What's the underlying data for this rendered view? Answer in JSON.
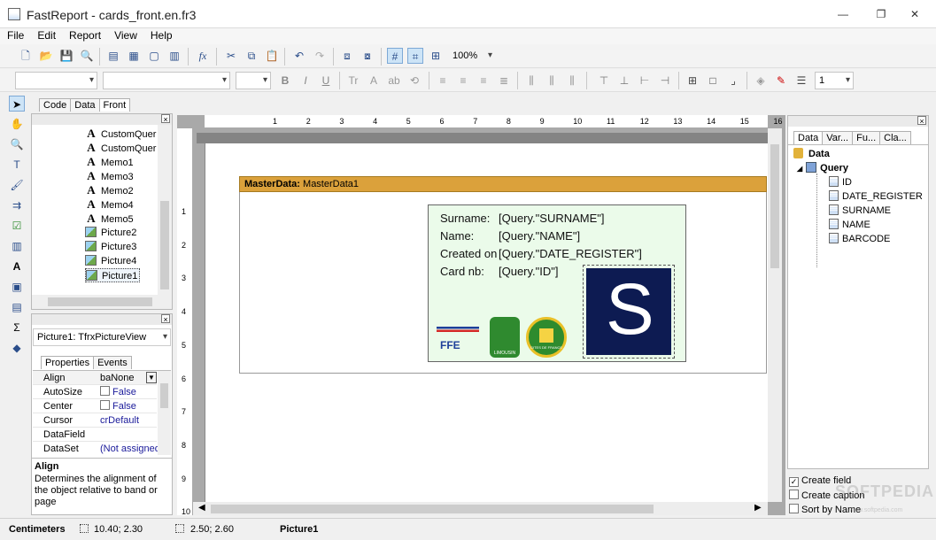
{
  "window": {
    "title": "FastReport - cards_front.en.fr3"
  },
  "menu": [
    "File",
    "Edit",
    "Report",
    "View",
    "Help"
  ],
  "toolbar": {
    "zoom": "100%",
    "line_width": "1"
  },
  "page_tabs": [
    "Code",
    "Data",
    "Front"
  ],
  "report_tree": {
    "items": [
      {
        "label": "CustomQuer",
        "icon": "text-icon"
      },
      {
        "label": "CustomQuer",
        "icon": "text-icon"
      },
      {
        "label": "Memo1",
        "icon": "text-icon"
      },
      {
        "label": "Memo3",
        "icon": "text-icon"
      },
      {
        "label": "Memo2",
        "icon": "text-icon"
      },
      {
        "label": "Memo4",
        "icon": "text-icon"
      },
      {
        "label": "Memo5",
        "icon": "text-icon"
      },
      {
        "label": "Picture2",
        "icon": "picture-icon"
      },
      {
        "label": "Picture3",
        "icon": "picture-icon"
      },
      {
        "label": "Picture4",
        "icon": "picture-icon"
      },
      {
        "label": "Picture1",
        "icon": "picture-icon"
      }
    ]
  },
  "inspector": {
    "object": "Picture1: TfrxPictureView",
    "tabs": [
      "Properties",
      "Events"
    ],
    "rows": [
      {
        "name": "Align",
        "value": "baNone"
      },
      {
        "name": "AutoSize",
        "value": "False"
      },
      {
        "name": "Center",
        "value": "False"
      },
      {
        "name": "Cursor",
        "value": "crDefault"
      },
      {
        "name": "DataField",
        "value": ""
      },
      {
        "name": "DataSet",
        "value": "(Not assigned"
      }
    ],
    "help_title": "Align",
    "help_text": "Determines the alignment of the object relative to band or page"
  },
  "ruler_h": [
    "1",
    "2",
    "3",
    "4",
    "5",
    "6",
    "7",
    "8",
    "9",
    "10",
    "11",
    "12",
    "13",
    "14",
    "15",
    "16"
  ],
  "ruler_v": [
    "1",
    "2",
    "3",
    "4",
    "5",
    "6",
    "7",
    "8",
    "9",
    "10"
  ],
  "band": {
    "type": "MasterData:",
    "name": "MasterData1"
  },
  "card": {
    "lines": [
      {
        "label": "Surname:",
        "field": "[Query.\"SURNAME\"]"
      },
      {
        "label": "Name:",
        "field": "[Query.\"NAME\"]"
      },
      {
        "label": "Created on",
        "field": "[Query.\"DATE_REGISTER\"]"
      },
      {
        "label": "Card nb:",
        "field": "[Query.\"ID\"]"
      }
    ],
    "big_logo_letter": "S",
    "ffe_text": "FFE",
    "limousin_text": "LIMOUSIN",
    "gites_text": "GITES DE FRANCE"
  },
  "data_panel": {
    "tabs": [
      "Data",
      "Var...",
      "Fu...",
      "Cla..."
    ],
    "root": "Data",
    "query": "Query",
    "fields": [
      "ID",
      "DATE_REGISTER",
      "SURNAME",
      "NAME",
      "BARCODE"
    ]
  },
  "options": {
    "create_field": "Create field",
    "create_caption": "Create caption",
    "sort_by_name": "Sort by Name"
  },
  "watermark": "SOFTPEDIA",
  "watermark_url": "www.softpedia.com",
  "status": {
    "units": "Centimeters",
    "position": "10.40; 2.30",
    "size": "2.50; 2.60",
    "selected": "Picture1"
  }
}
